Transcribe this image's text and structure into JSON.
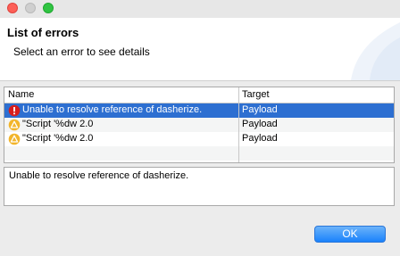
{
  "header": {
    "title": "List of errors",
    "subtitle": "Select an error to see details"
  },
  "table": {
    "columns": {
      "name": "Name",
      "target": "Target"
    },
    "rows": [
      {
        "icon": "error-icon",
        "name": "Unable to resolve reference of dasherize.",
        "target": "Payload",
        "selected": true
      },
      {
        "icon": "warning-icon",
        "name": "\"Script '%dw 2.0",
        "target": "Payload",
        "selected": false
      },
      {
        "icon": "warning-icon",
        "name": "\"Script '%dw 2.0",
        "target": "Payload",
        "selected": false
      }
    ]
  },
  "details": {
    "text": "Unable to resolve reference of dasherize."
  },
  "buttons": {
    "ok_label": "OK"
  },
  "colors": {
    "selection": "#2d6fd1",
    "ok_button": "#1a82fb",
    "error": "#d81d1d",
    "warning": "#f2b52b"
  }
}
